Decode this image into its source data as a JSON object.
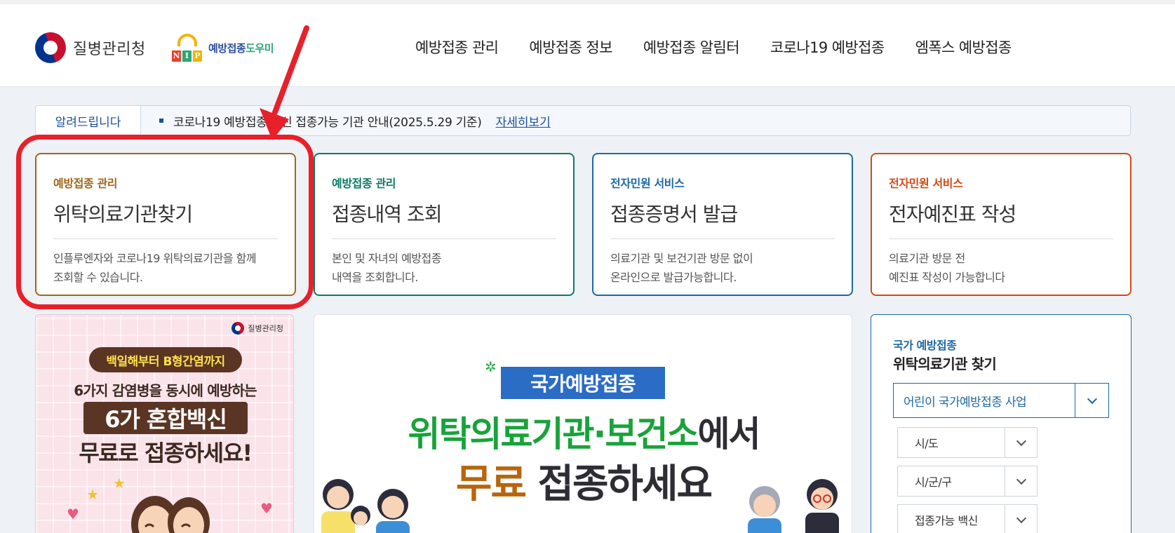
{
  "header": {
    "logo_text": "질병관리청",
    "nip_logo": {
      "letters": [
        "N",
        "I",
        "P"
      ],
      "text_a": "예방접종",
      "text_b": "도우미"
    },
    "nav": [
      "예방접종 관리",
      "예방접종 정보",
      "예방접종 알림터",
      "코로나19 예방접종",
      "엠폭스 예방접종"
    ]
  },
  "notice": {
    "label": "알려드립니다",
    "text": "코로나19 예방접종 백신 접종가능 기관 안내(2025.5.29 기준)",
    "more": "자세히보기"
  },
  "cards": [
    {
      "category": "예방접종 관리",
      "title": "위탁의료기관찾기",
      "desc": "인플루엔자와 코로나19 위탁의료기관을 함께\n조회할 수 있습니다."
    },
    {
      "category": "예방접종 관리",
      "title": "접종내역 조회",
      "desc": "본인 및 자녀의 예방접종\n내역을 조회합니다."
    },
    {
      "category": "전자민원 서비스",
      "title": "접종증명서 발급",
      "desc": "의료기관 및 보건기관 방문 없이\n온라인으로 발급가능합니다."
    },
    {
      "category": "전자민원 서비스",
      "title": "전자예진표 작성",
      "desc": "의료기관 방문 전\n예진표 작성이 가능합니다"
    }
  ],
  "banner_left": {
    "org": "질병관리청",
    "pill": "백일해부터 B형간염까지",
    "line1": "6가지 감염병을 동시에 예방하는",
    "line2": "6가 혼합백신",
    "line3": "무료로 접종하세요!"
  },
  "banner_center": {
    "tag": "국가예방접종",
    "line1_green": "위탁의료기관·보건소",
    "line1_dark": "에서",
    "line2_orange": "무료",
    "line2_dark": " 접종하세요"
  },
  "search_panel": {
    "category": "국가 예방접종",
    "title": "위탁의료기관 찾기",
    "program_select": "어린이 국가예방접종 사업",
    "selects": [
      "시/도",
      "시/군/구",
      "접종가능 백신"
    ]
  },
  "colors": {
    "annotation_red": "#e8202a",
    "card1": "#a0661b",
    "card2": "#0b7a66",
    "card3": "#1d68a6",
    "card4": "#d44a14"
  }
}
